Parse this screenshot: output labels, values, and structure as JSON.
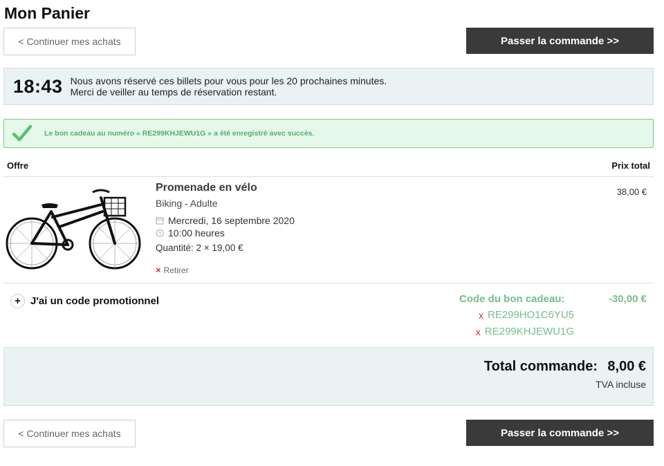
{
  "page_title": "Mon Panier",
  "continue_label": "< Continuer mes achats",
  "order_label": "Passer la commande >>",
  "timer": {
    "value": "18:43",
    "line1": "Nous avons réservé ces billets pour vous pour les 20 prochaines minutes.",
    "line2": "Merci de veiller au temps de réservation restant."
  },
  "success_message": "Le bon cadeau au numéro « RE299KHJEWU1G » a été enregistré avec succès.",
  "table": {
    "col_offer": "Offre",
    "col_total": "Prix total"
  },
  "item": {
    "name": "Promenade en vélo",
    "category": "Biking - Adulte",
    "date": "Mercredi, 16 septembre 2020",
    "time": "10:00 heures",
    "quantity": "Quantité: 2 × 19,00 €",
    "remove_label": "Retirer",
    "price": "38,00 €",
    "image_icon": "bicycle-image"
  },
  "promo_label": "J'ai un code promotionnel",
  "gift": {
    "label": "Code du bon cadeau:",
    "amount": "-30,00 €",
    "codes": [
      "RE299HO1C6YU5",
      "RE299KHJEWU1G"
    ],
    "remove_symbol": "x"
  },
  "total": {
    "label": "Total commande:",
    "value": "8,00 €",
    "tax_note": "TVA incluse"
  },
  "colors": {
    "accent_green": "#74bf87",
    "button_dark": "#3a3a3a",
    "info_bg": "#ebf2f3",
    "remove_red": "#d92b2b"
  }
}
